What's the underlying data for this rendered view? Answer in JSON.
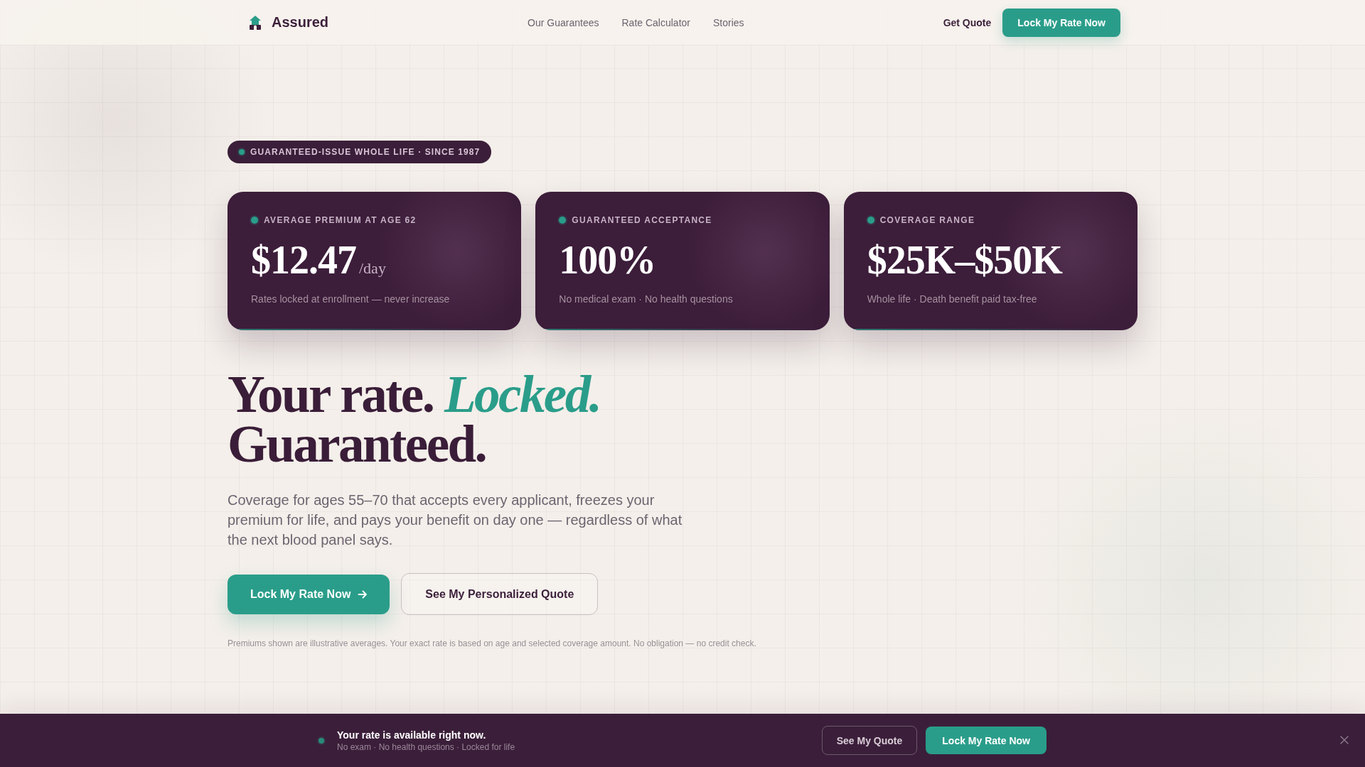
{
  "nav": {
    "brand": "Assured",
    "links": [
      {
        "label": "Our Guarantees"
      },
      {
        "label": "Rate Calculator"
      },
      {
        "label": "Stories"
      }
    ],
    "secondary_link": "Get Quote",
    "primary_button": "Lock My Rate Now"
  },
  "hero": {
    "eyebrow": "GUARANTEED-ISSUE WHOLE LIFE · SINCE 1987",
    "stats": [
      {
        "label": "AVERAGE PREMIUM AT AGE 62",
        "value": "$12.47",
        "unit": "/day",
        "note": "Rates locked at enrollment — never increase"
      },
      {
        "label": "GUARANTEED ACCEPTANCE",
        "value": "100%",
        "note": "No medical exam · No health questions"
      },
      {
        "label": "COVERAGE RANGE",
        "value": "$25K–$50K",
        "note": "Whole life · Death benefit paid tax-free"
      }
    ],
    "headline": [
      "Your rate. *Locked.*",
      "Guaranteed."
    ],
    "lead": "Coverage for ages 55–70 that accepts every applicant, freezes your premium for life, and pays your benefit on day one — regardless of what the next blood panel says.",
    "buttons": [
      {
        "kind": "primary",
        "label": "Lock My Rate Now"
      },
      {
        "kind": "secondary",
        "label": "See My Personalized Quote"
      }
    ],
    "disclaimer": "Premiums shown are illustrative averages. Your exact rate is based on age and selected coverage amount. No obligation — no credit check."
  },
  "sticky_bar": {
    "title": "Your rate is available right now.",
    "subtitle": "No exam · No health questions · Locked for life",
    "buttons": [
      {
        "kind": "secondary",
        "label": "See My Quote"
      },
      {
        "kind": "primary",
        "label": "Lock My Rate Now"
      }
    ]
  }
}
